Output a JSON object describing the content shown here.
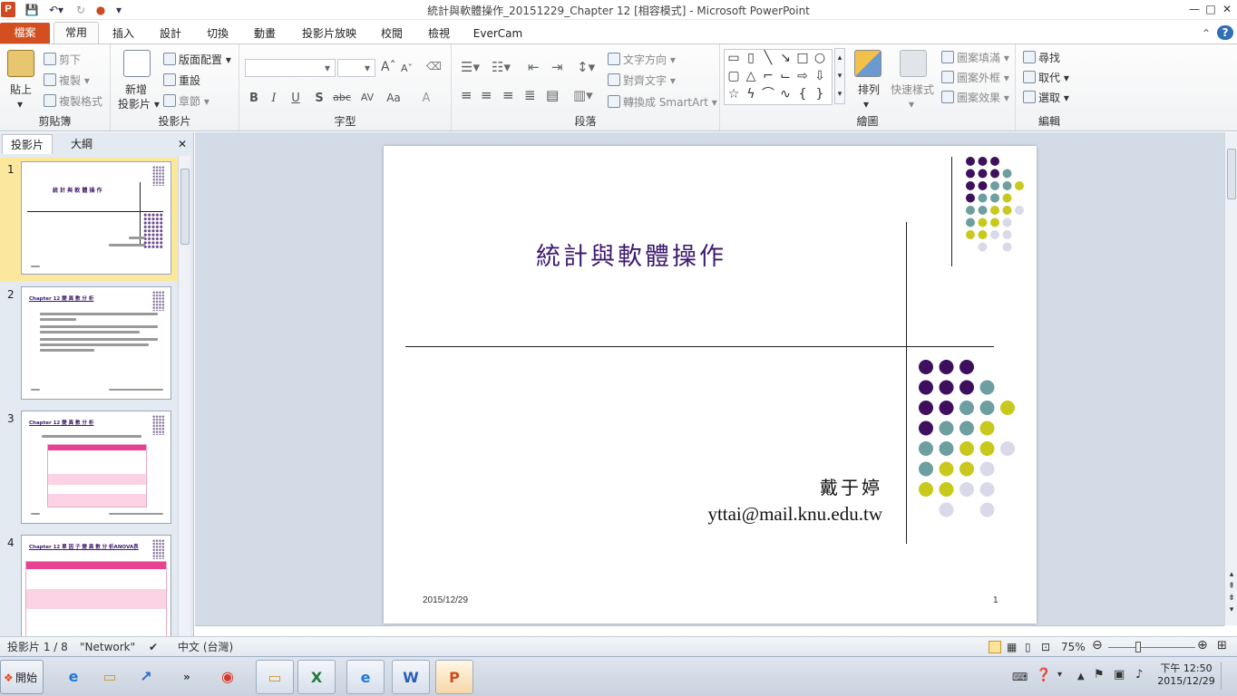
{
  "app": {
    "title": "統計與軟體操作_20151229_Chapter 12 [相容模式] - Microsoft PowerPoint",
    "app_icon_letter": "P"
  },
  "window_buttons": {
    "minimize": "—",
    "maximize": "□",
    "close": "✕"
  },
  "ribbon_tabs": [
    "檔案",
    "常用",
    "插入",
    "設計",
    "切換",
    "動畫",
    "投影片放映",
    "校閱",
    "檢視",
    "EverCam"
  ],
  "ribbon": {
    "clipboard": {
      "label": "剪貼簿",
      "paste": "貼上",
      "cut": "剪下",
      "copy": "複製",
      "format_painter": "複製格式"
    },
    "slides": {
      "label": "投影片",
      "new_slide_1": "新增",
      "new_slide_2": "投影片",
      "layout": "版面配置",
      "reset": "重設",
      "section": "章節"
    },
    "font": {
      "label": "字型",
      "bold": "B",
      "italic": "I",
      "underline": "U",
      "shadow": "S",
      "strike": "abc",
      "spacing": "AV",
      "case": "Aa",
      "color": "A",
      "grow": "A",
      "shrink": "A"
    },
    "paragraph": {
      "label": "段落",
      "text_direction": "文字方向",
      "align_text": "對齊文字",
      "smartart": "轉換成 SmartArt"
    },
    "drawing": {
      "label": "繪圖",
      "arrange": "排列",
      "quick_styles": "快速樣式",
      "shape_fill": "圖案填滿",
      "shape_outline": "圖案外框",
      "shape_effects": "圖案效果"
    },
    "editing": {
      "label": "編輯",
      "find": "尋找",
      "replace": "取代",
      "select": "選取"
    }
  },
  "left_panel": {
    "tab_slides": "投影片",
    "tab_outline": "大綱",
    "close": "✕"
  },
  "thumbnails": [
    {
      "num": "1",
      "title": "統 計 與 軟 體 操 作"
    },
    {
      "num": "2",
      "title": "Chapter 12 變 異 數 分 析"
    },
    {
      "num": "3",
      "title": "Chapter 12 變 異 數 分 析"
    },
    {
      "num": "4",
      "title": "Chapter 12 單 因 子 變 異 數 分 析ANOVA表"
    }
  ],
  "slide": {
    "title": "統計與軟體操作",
    "author": "戴于婷",
    "email": "yttai@mail.knu.edu.tw",
    "date": "2015/12/29",
    "page": "1"
  },
  "colors": {
    "purple": "#3d0f5e",
    "teal": "#6d9ea0",
    "yellow": "#c8c81d",
    "lavender": "#d9d9ea",
    "accent_file_tab": "#d34f20"
  },
  "status_bar": {
    "slide_info": "投影片 1 / 8",
    "theme": "\"Network\"",
    "language": "中文 (台灣)",
    "zoom": "75%"
  },
  "taskbar": {
    "start": "開始",
    "time": "下午 12:50",
    "date": "2015/12/29"
  }
}
